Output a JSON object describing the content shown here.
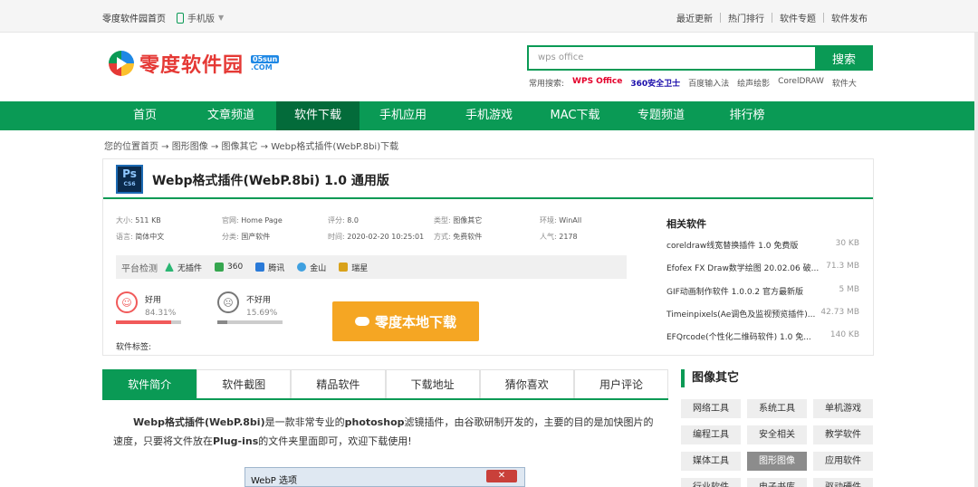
{
  "topbar": {
    "home": "零度软件园首页",
    "mobile": "手机版",
    "links": [
      "最近更新",
      "热门排行",
      "软件专题",
      "软件发布"
    ]
  },
  "logo": {
    "text": "零度软件园",
    "badge": "05sun",
    "domain": ".COM"
  },
  "search": {
    "placeholder": "wps office",
    "button": "搜索",
    "hot_label": "常用搜索:",
    "hot": [
      "WPS Office",
      "360安全卫士",
      "百度输入法",
      "绘声绘影",
      "CorelDRAW",
      "软件大"
    ]
  },
  "nav": {
    "items": [
      "首页",
      "文章频道",
      "软件下载",
      "手机应用",
      "手机游戏",
      "MAC下载",
      "专题频道",
      "排行榜"
    ],
    "active": "软件下载"
  },
  "breadcrumb": "您的位置首页 → 图形图像 → 图像其它 → Webp格式插件(WebP.8bi)下载",
  "software": {
    "icon_text": "Ps",
    "icon_sub": "CS6",
    "title": "Webp格式插件(WebP.8bi) 1.0 通用版",
    "meta": {
      "size_k": "大小:",
      "size_v": "511 KB",
      "site_k": "官网:",
      "site_v": "Home Page",
      "score_k": "评分:",
      "score_v": "8.0",
      "type_k": "类型:",
      "type_v": "图像其它",
      "env_k": "环境:",
      "env_v": "WinAll",
      "lang_k": "语言:",
      "lang_v": "简体中文",
      "cat_k": "分类:",
      "cat_v": "国产软件",
      "time_k": "时间:",
      "time_v": "2020-02-20 10:25:01",
      "mode_k": "方式:",
      "mode_v": "免费软件",
      "pop_k": "人气:",
      "pop_v": "2178"
    },
    "detect": {
      "label": "平台检测",
      "items": [
        "无插件",
        "360",
        "腾讯",
        "金山",
        "瑞星"
      ]
    },
    "vote": {
      "good": "好用",
      "good_pct": "84.31%",
      "good_value": 84.31,
      "bad": "不好用",
      "bad_pct": "15.69%",
      "bad_value": 15.69
    },
    "tags_label": "软件标签:",
    "download": "零度本地下载"
  },
  "related": {
    "title": "相关软件",
    "items": [
      {
        "name": "coreldraw线宽替换插件 1.0 免费版",
        "size": "30 KB"
      },
      {
        "name": "Efofex FX Draw数学绘图 20.02.06 破...",
        "size": "71.3 MB"
      },
      {
        "name": "GIF动画制作软件 1.0.0.2 官方最新版",
        "size": "5 MB"
      },
      {
        "name": "Timeinpixels(Ae调色及监视预览插件)...",
        "size": "42.73 MB"
      },
      {
        "name": "EFQrcode(个性化二维码软件) 1.0 免...",
        "size": "140 KB"
      }
    ]
  },
  "tabs": [
    "软件简介",
    "软件截图",
    "精品软件",
    "下载地址",
    "猜你喜欢",
    "用户评论"
  ],
  "description": {
    "lead": "Webp格式插件(WebP.8bi)",
    "mid1": "是一款非常专业的",
    "b2": "photoshop",
    "mid2": "滤镜插件，由谷歌研制开发的，主要的目的是加快图片的速度，只要将文件放在",
    "b3": "Plug-ins",
    "tail": "的文件夹里面即可，欢迎下载使用!"
  },
  "screenshot": {
    "title": "WebP 选项",
    "close": "✕"
  },
  "category": {
    "title": "图像其它",
    "items": [
      "网络工具",
      "系统工具",
      "单机游戏",
      "编程工具",
      "安全相关",
      "教学软件",
      "媒体工具",
      "图形图像",
      "应用软件",
      "行业软件",
      "电子书库",
      "驱动硬件"
    ],
    "selected": "图形图像"
  },
  "colors": {
    "brand_green": "#0a9a55",
    "nav_active": "#036b3a",
    "download_orange": "#f5a623",
    "good_red": "#f15a5a",
    "bad_gray": "#888888"
  }
}
